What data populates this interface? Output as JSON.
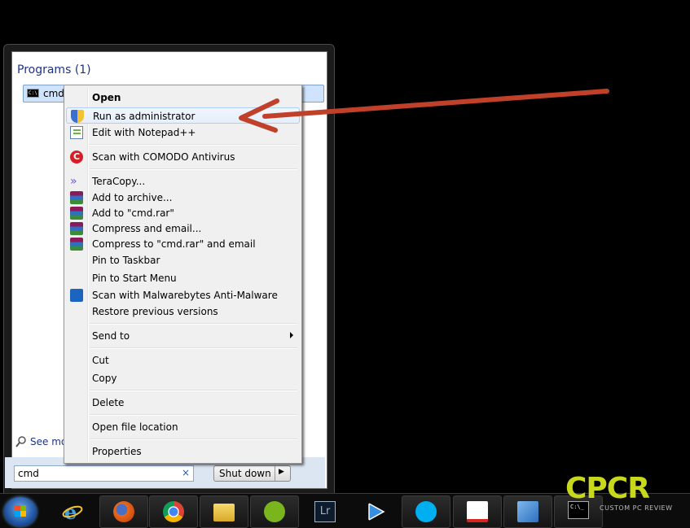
{
  "start_menu": {
    "programs_heading": "Programs (1)",
    "program_item_label": "cmd.exe",
    "program_icon_text": "C:\\",
    "see_more": "See more results",
    "search_value": "cmd",
    "search_clear": "×",
    "shutdown_label": "Shut down",
    "shutdown_arrow": "▶"
  },
  "context_menu": {
    "items": [
      {
        "label": "Open",
        "icon": ""
      },
      {
        "label": "Run as administrator",
        "icon": "shield-icon"
      },
      {
        "label": "Edit with Notepad++",
        "icon": "notepad-icon"
      },
      {
        "label": "Scan with COMODO Antivirus",
        "icon": "comodo-icon"
      },
      {
        "label": "TeraCopy...",
        "icon": "teracopy-icon"
      },
      {
        "label": "Add to archive...",
        "icon": "winrar-icon"
      },
      {
        "label": "Add to \"cmd.rar\"",
        "icon": "winrar-icon"
      },
      {
        "label": "Compress and email...",
        "icon": "winrar-icon"
      },
      {
        "label": "Compress to \"cmd.rar\" and email",
        "icon": "winrar-icon"
      },
      {
        "label": "Pin to Taskbar",
        "icon": ""
      },
      {
        "label": "Pin to Start Menu",
        "icon": ""
      },
      {
        "label": "Scan with Malwarebytes Anti-Malware",
        "icon": "malwarebytes-icon"
      },
      {
        "label": "Restore previous versions",
        "icon": ""
      },
      {
        "label": "Send to",
        "icon": ""
      },
      {
        "label": "Cut",
        "icon": ""
      },
      {
        "label": "Copy",
        "icon": ""
      },
      {
        "label": "Delete",
        "icon": ""
      },
      {
        "label": "Open file location",
        "icon": ""
      },
      {
        "label": "Properties",
        "icon": ""
      }
    ],
    "comodo_glyph": "C",
    "teracopy_glyph": "»"
  },
  "taskbar": {
    "apps": [
      "internet-explorer",
      "firefox",
      "chrome",
      "file-explorer",
      "spotify",
      "lightroom",
      "media-player",
      "skype",
      "adobe-reader",
      "control-panel",
      "command-prompt"
    ],
    "lightroom_text": "Lr",
    "cmd_text": "C:\\_"
  },
  "watermark": {
    "logo": "CPCR",
    "tagline": "CUSTOM PC REVIEW"
  },
  "colors": {
    "arrow": "#c0402a",
    "highlight": "#e5eefb",
    "logo": "#c8d81a"
  }
}
